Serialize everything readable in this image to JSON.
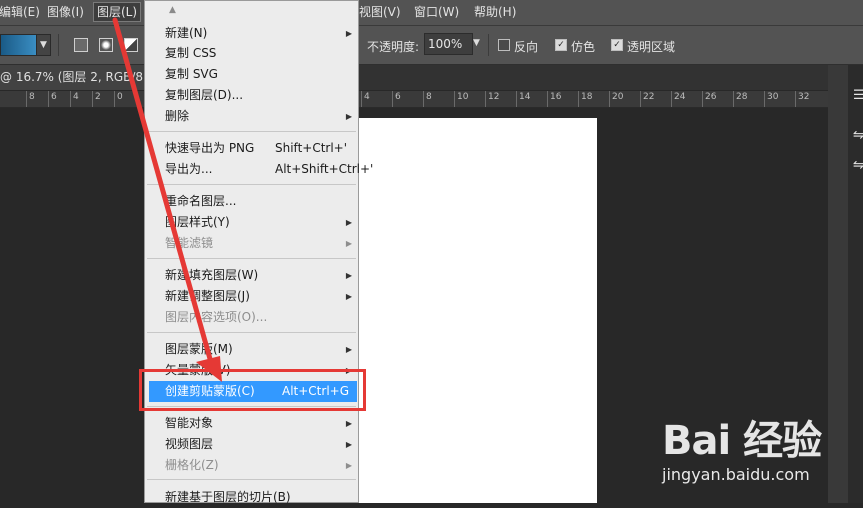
{
  "menubar": {
    "items": [
      {
        "label": "编辑(E)"
      },
      {
        "label": "图像(I)"
      },
      {
        "label": "图层(L)"
      },
      {
        "label": "视图(V)"
      },
      {
        "label": "窗口(W)"
      },
      {
        "label": "帮助(H)"
      }
    ]
  },
  "optbar": {
    "opacity_label": "不透明度:",
    "opacity_value": "100%",
    "reverse_label": "反向",
    "dither_label": "仿色",
    "transparency_label": "透明区域",
    "reverse_checked": false,
    "dither_checked": true,
    "transparency_checked": true
  },
  "doc_tab": {
    "title": "@ 16.7% (图层 2, RGB/8) *"
  },
  "ruler": {
    "ticks": [
      "8",
      "6",
      "4",
      "2",
      "0",
      "2",
      "4",
      "6",
      "8",
      "10",
      "12",
      "14",
      "16",
      "18",
      "20",
      "22",
      "24",
      "26",
      "28",
      "30",
      "32"
    ]
  },
  "menu": {
    "items": [
      {
        "label": "新建(N)",
        "shortcut": "",
        "submenu": true,
        "disabled": false
      },
      {
        "label": "复制 CSS",
        "shortcut": "",
        "submenu": false,
        "disabled": false
      },
      {
        "label": "复制 SVG",
        "shortcut": "",
        "submenu": false,
        "disabled": false
      },
      {
        "label": "复制图层(D)...",
        "shortcut": "",
        "submenu": false,
        "disabled": false
      },
      {
        "label": "删除",
        "shortcut": "",
        "submenu": true,
        "disabled": false
      },
      {
        "label": "快速导出为 PNG",
        "shortcut": "Shift+Ctrl+'",
        "submenu": false,
        "disabled": false
      },
      {
        "label": "导出为...",
        "shortcut": "Alt+Shift+Ctrl+'",
        "submenu": false,
        "disabled": false
      },
      {
        "label": "重命名图层...",
        "shortcut": "",
        "submenu": false,
        "disabled": false
      },
      {
        "label": "图层样式(Y)",
        "shortcut": "",
        "submenu": true,
        "disabled": false
      },
      {
        "label": "智能滤镜",
        "shortcut": "",
        "submenu": true,
        "disabled": true
      },
      {
        "label": "新建填充图层(W)",
        "shortcut": "",
        "submenu": true,
        "disabled": false
      },
      {
        "label": "新建调整图层(J)",
        "shortcut": "",
        "submenu": true,
        "disabled": false
      },
      {
        "label": "图层内容选项(O)...",
        "shortcut": "",
        "submenu": false,
        "disabled": true
      },
      {
        "label": "图层蒙版(M)",
        "shortcut": "",
        "submenu": true,
        "disabled": false
      },
      {
        "label": "矢量蒙版(V)",
        "shortcut": "",
        "submenu": true,
        "disabled": false
      },
      {
        "label": "创建剪贴蒙版(C)",
        "shortcut": "Alt+Ctrl+G",
        "submenu": false,
        "disabled": false,
        "highlighted": true
      },
      {
        "label": "智能对象",
        "shortcut": "",
        "submenu": true,
        "disabled": false
      },
      {
        "label": "视频图层",
        "shortcut": "",
        "submenu": true,
        "disabled": false
      },
      {
        "label": "栅格化(Z)",
        "shortcut": "",
        "submenu": true,
        "disabled": true
      },
      {
        "label": "新建基于图层的切片(B)",
        "shortcut": "",
        "submenu": false,
        "disabled": false
      }
    ]
  },
  "watermark": {
    "brand": "Bai 经验",
    "url": "jingyan.baidu.com"
  },
  "colors": {
    "highlight": "#3399ff",
    "annotation_red": "#e53935"
  }
}
